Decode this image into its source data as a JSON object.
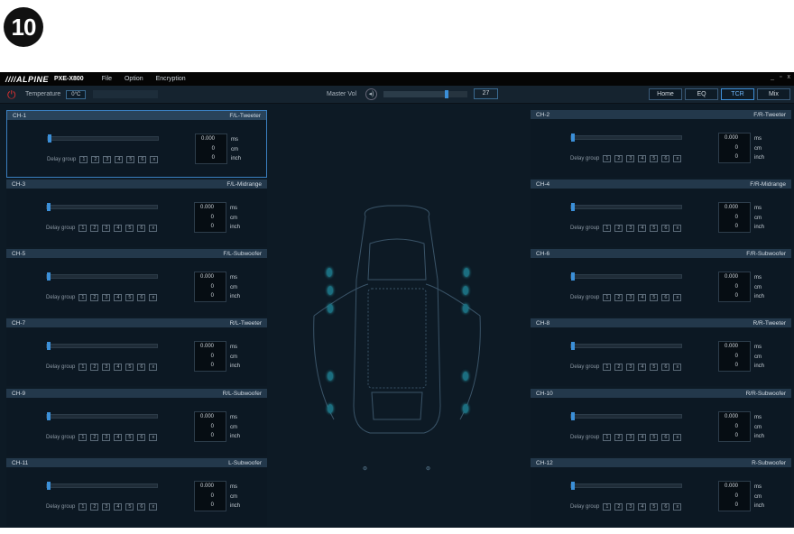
{
  "step_number": "10",
  "app": {
    "logo": "////ALPINE",
    "model": "PXE-X800",
    "menu": [
      "File",
      "Option",
      "Encryption"
    ],
    "window_controls": [
      "_",
      "▫",
      "x"
    ]
  },
  "toolbar": {
    "temperature_label": "Temperature",
    "temperature_value": "0°C",
    "master_vol_label": "Master Vol",
    "master_vol_value": "27",
    "master_vol_level": 0.75,
    "nav": [
      "Home",
      "EQ",
      "TCR",
      "Mix"
    ],
    "active_nav": "TCR"
  },
  "panel_common": {
    "delay_group_label": "Delay group",
    "group_buttons": [
      "1",
      "2",
      "3",
      "4",
      "5",
      "6",
      "x"
    ],
    "units": [
      "ms",
      "cm",
      "inch"
    ]
  },
  "channels": [
    {
      "ch": "CH-1",
      "name": "F/L-Tweeter",
      "ms": "0.000",
      "cm": "0",
      "inch": "0"
    },
    {
      "ch": "CH-2",
      "name": "F/R-Tweeter",
      "ms": "0.000",
      "cm": "0",
      "inch": "0"
    },
    {
      "ch": "CH-3",
      "name": "F/L-Midrange",
      "ms": "0.000",
      "cm": "0",
      "inch": "0"
    },
    {
      "ch": "CH-4",
      "name": "F/R-Midrange",
      "ms": "0.000",
      "cm": "0",
      "inch": "0"
    },
    {
      "ch": "CH-5",
      "name": "F/L-Subwoofer",
      "ms": "0.000",
      "cm": "0",
      "inch": "0"
    },
    {
      "ch": "CH-6",
      "name": "F/R-Subwoofer",
      "ms": "0.000",
      "cm": "0",
      "inch": "0"
    },
    {
      "ch": "CH-7",
      "name": "R/L-Tweeter",
      "ms": "0.000",
      "cm": "0",
      "inch": "0"
    },
    {
      "ch": "CH-8",
      "name": "R/R-Tweeter",
      "ms": "0.000",
      "cm": "0",
      "inch": "0"
    },
    {
      "ch": "CH-9",
      "name": "R/L-Subwoofer",
      "ms": "0.000",
      "cm": "0",
      "inch": "0"
    },
    {
      "ch": "CH-10",
      "name": "R/R-Subwoofer",
      "ms": "0.000",
      "cm": "0",
      "inch": "0"
    },
    {
      "ch": "CH-11",
      "name": "L-Subwoofer",
      "ms": "0.000",
      "cm": "0",
      "inch": "0"
    },
    {
      "ch": "CH-12",
      "name": "R-Subwoofer",
      "ms": "0.000",
      "cm": "0",
      "inch": "0"
    }
  ],
  "selected_channel": "CH-1",
  "colors": {
    "accent": "#3b8fd8",
    "power": "#e03030",
    "panel_header": "#23384b",
    "background": "#0d1a25"
  }
}
